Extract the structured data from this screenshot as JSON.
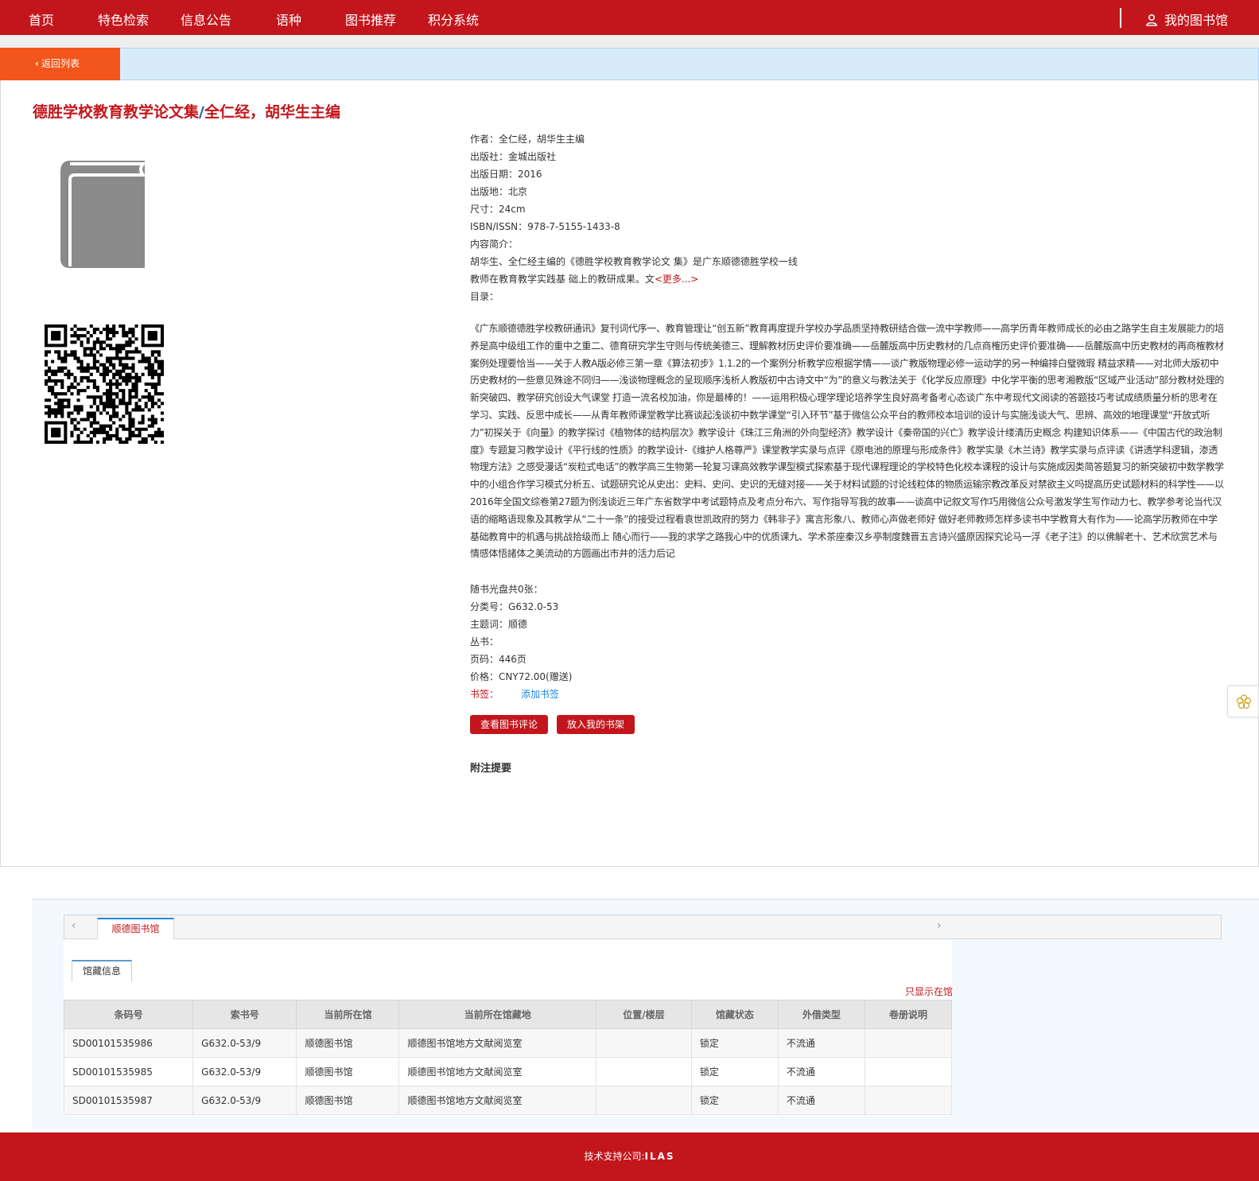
{
  "nav": {
    "items": [
      {
        "label": "首页"
      },
      {
        "label": "特色检索"
      },
      {
        "label": "信息公告"
      },
      {
        "label": "语种"
      },
      {
        "label": "图书推荐"
      },
      {
        "label": "积分系统"
      }
    ],
    "my_library": "我的图书馆"
  },
  "back_label": "返回列表",
  "book": {
    "title": "德胜学校教育教学论文集",
    "separator": "/",
    "responsibility": "全仁经，胡华生主编",
    "cover_icon": "book-icon",
    "meta": [
      {
        "label": "作者：",
        "value": "全仁经，胡华生主编"
      },
      {
        "label": "出版社：",
        "value": "金城出版社"
      },
      {
        "label": "出版日期：",
        "value": "2016"
      },
      {
        "label": "出版地：",
        "value": "北京"
      },
      {
        "label": "尺寸：",
        "value": "24cm"
      },
      {
        "label": "ISBN/ISSN：",
        "value": "978-7-5155-1433-8"
      }
    ],
    "summary_label": "内容简介：",
    "summary_line1": "胡华生、全仁经主编的《德胜学校教育教学论文 集》是广东顺德德胜学校一线",
    "summary_line2": "教师在教育教学实践基 础上的教研成果。文",
    "more_link": "<更多...>",
    "toc_label": "目录：",
    "toc_text": "《广东顺德德胜学校教研通讯》复刊词代序一、教育管理让“创五新”教育再度提升学校办学品质坚持教研结合做一流中学教师——高学历青年教师成长的必由之路学生自主发展能力的培养是高中级组工作的重中之重二、德育研究学生守则与传统美德三、理解教材历史评价要准确——岳麓版高中历史教材的几点商榷历史评价要准确——岳麓版高中历史教材的再商榷教材案例处理要恰当——关于人教A版必修三第一章《算法初步》1.1.2的一个案例分析教学应根据学情——谈广教版物理必修一运动学的另一种编排白璧微瑕 精益求精——对北师大版初中历史教材的一些意见殊途不同归——浅谈物理概念的呈现顺序浅析人教版初中古诗文中“为”的意义与教法关于《化学反应原理》中化学平衡的思考湘教版“区域产业活动”部分教材处理的新突破四、教学研究创设大气课堂 打造一流名校加油，你是最棒的！——运用积极心理学理论培养学生良好高考备考心态谈广东中考现代文阅读的答题技巧考试成绩质量分析的思考在学习、实践、反思中成长——从青年教师课堂教学比赛谈起浅谈初中数学课堂“引入环节”基于微信公众平台的教师校本培训的设计与实施浅谈大气、思辨、高效的地理课堂“开放式听力”初探关于《向量》的教学探讨《植物体的结构层次》教学设计《珠江三角洲的外向型经济》教学设计《秦帝国的兴亡》教学设计缕清历史概念 构建知识体系——《中国古代的政治制度》专题复习教学设计《平行线的性质》的教学设计-《维护人格尊严》课堂教学实录与点评《原电池的原理与形成条件》教学实录《木兰诗》教学实录与点评读《讲透学科逻辑，渗透物理方法》之感受漫话“炭粒式电话”的教学高三生物第一轮复习课高效教学课型模式探索基于现代课程理论的学校特色化校本课程的设计与实施成因类简答题复习的新突破初中数学教学中的小组合作学习模式分析五、试题研究论从史出：史料、史问、史识的无缝对接——关于材料试题的讨论线粒体的物质运输宗教改革反对禁欲主义吗提高历史试题材料的科学性——以2016年全国文综卷第27题为例浅谈近三年广东省数学中考试题特点及考点分布六、写作指导写我的故事——谈高中记叙文写作巧用微信公众号激发学生写作动力七、教学参考论当代汉语的缩略语现象及其教学从“二十一条”的接受过程看袁世凯政府的努力《韩非子》寓言形象八、教师心声做老师好 做好老师教师怎样多读书中学教育大有作为——论高学历教师在中学基础教育中的机遇与挑战拾级而上 随心而行——我的求学之路我心中的优质课九、学术茶座秦汉乡亭制度魏晋五言诗兴盛原因探究论马一浮《老子注》的以佛解老十、艺术欣赏艺术与情感体悟諸体之美流动的方圆画出市井的活力后记",
    "meta2": [
      {
        "label": "随书光盘共0张：",
        "value": ""
      },
      {
        "label": "分类号：",
        "value": "G632.0-53"
      },
      {
        "label": "主题词：",
        "value": "顺德"
      },
      {
        "label": "丛书：",
        "value": ""
      },
      {
        "label": "页码：",
        "value": "446页"
      },
      {
        "label": "价格：",
        "value": "CNY72.00(赠送)"
      }
    ],
    "bookmark_label": "书签：",
    "bookmark_add": "添加书签",
    "btn_review": "查看图书评论",
    "btn_shelf": "放入我的书架",
    "notes_title": "附注提要"
  },
  "holdings": {
    "library_tab": "顺德图书馆",
    "info_tab": "馆藏信息",
    "only_in_library": "只显示在馆",
    "columns": [
      "条码号",
      "索书号",
      "当前所在馆",
      "当前所在馆藏地",
      "位置/楼层",
      "馆藏状态",
      "外借类型",
      "卷册说明"
    ],
    "rows": [
      [
        "SD00101535986",
        "G632.0-53/9",
        "顺德图书馆",
        "顺德图书馆地方文献阅览室",
        "",
        "锁定",
        "不流通",
        ""
      ],
      [
        "SD00101535985",
        "G632.0-53/9",
        "顺德图书馆",
        "顺德图书馆地方文献阅览室",
        "",
        "锁定",
        "不流通",
        ""
      ],
      [
        "SD00101535987",
        "G632.0-53/9",
        "顺德图书馆",
        "顺德图书馆地方文献阅览室",
        "",
        "锁定",
        "不流通",
        ""
      ]
    ]
  },
  "footer": {
    "label": "技术支持公司:",
    "company": "ILAS"
  },
  "colors": {
    "brand_red": "#c3161c",
    "back_orange": "#f2561c",
    "link_blue": "#1e88e5"
  }
}
